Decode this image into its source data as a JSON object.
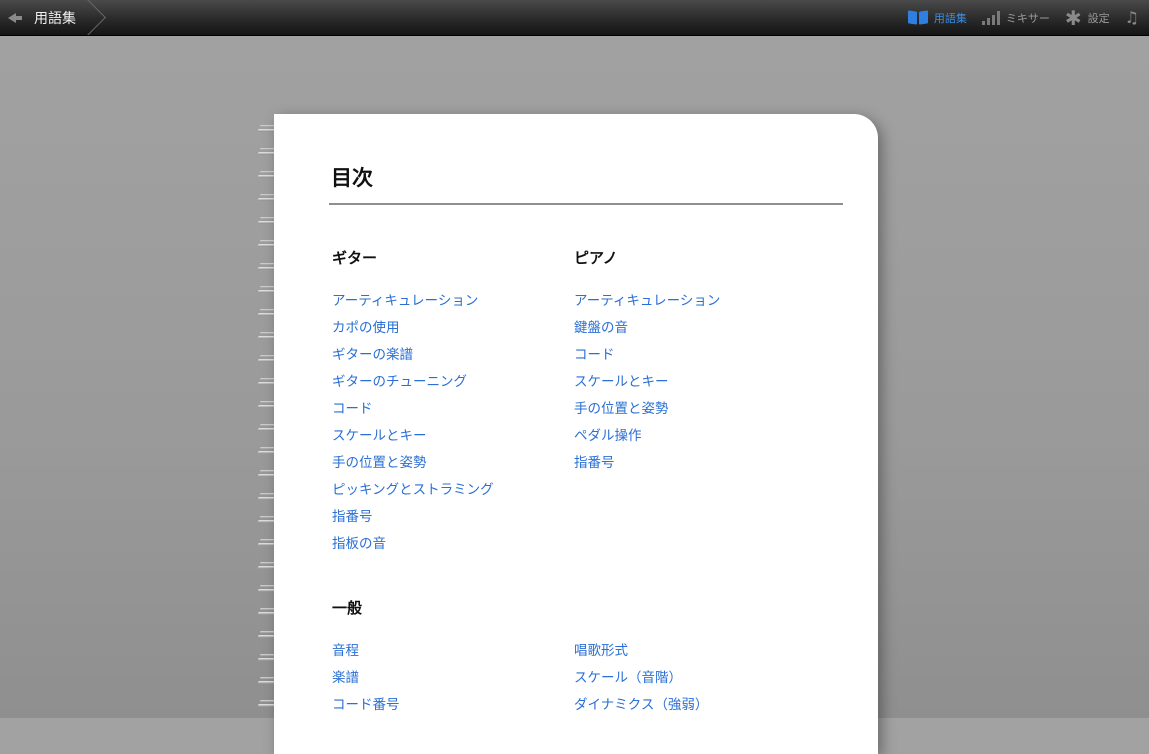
{
  "toolbar": {
    "back_label": "用語集",
    "items": [
      {
        "icon": "book-icon",
        "label": "用語集",
        "active": true
      },
      {
        "icon": "mixer-icon",
        "label": "ミキサー",
        "active": false
      },
      {
        "icon": "gear-icon",
        "label": "設定",
        "active": false
      },
      {
        "icon": "music-note-icon",
        "label": "",
        "active": false
      }
    ]
  },
  "page": {
    "title": "目次",
    "guitar": {
      "title": "ギター",
      "items": [
        "アーティキュレーション",
        "カポの使用",
        "ギターの楽譜",
        "ギターのチューニング",
        "コード",
        "スケールとキー",
        "手の位置と姿勢",
        "ピッキングとストラミング",
        "指番号",
        "指板の音"
      ]
    },
    "piano": {
      "title": "ピアノ",
      "items": [
        "アーティキュレーション",
        "鍵盤の音",
        "コード",
        "スケールとキー",
        "手の位置と姿勢",
        "ペダル操作",
        "指番号"
      ]
    },
    "general": {
      "title": "一般",
      "left_items": [
        "音程",
        "楽譜",
        "コード番号"
      ],
      "right_items": [
        "唱歌形式",
        "スケール（音階）",
        "ダイナミクス（強弱）"
      ]
    }
  },
  "colors": {
    "link": "#2a6fd6",
    "active": "#3a8ee6"
  }
}
